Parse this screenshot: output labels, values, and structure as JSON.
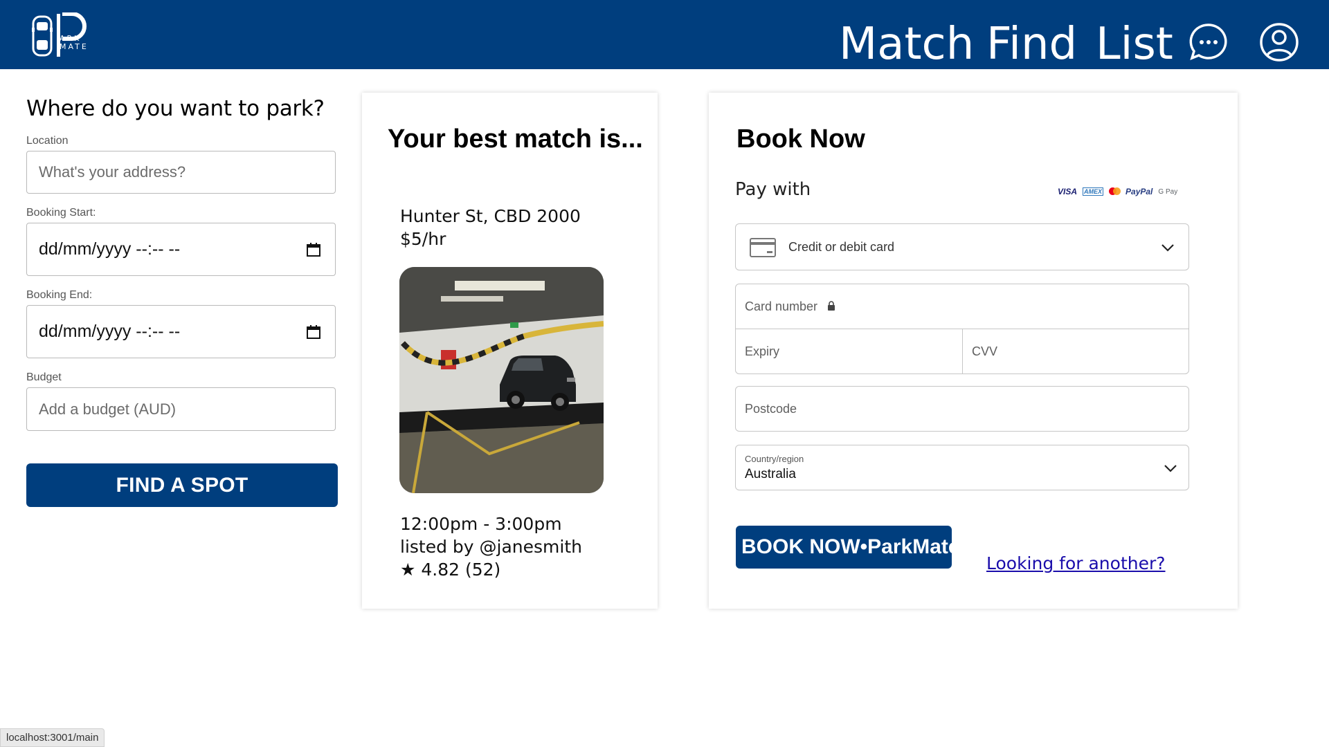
{
  "header": {
    "logo_text": "ARK MATE",
    "nav": [
      "Match",
      "Find",
      "List"
    ],
    "chat_icon": "chat-bubble-icon",
    "profile_icon": "user-circle-icon",
    "bg_color": "#003e7e"
  },
  "search": {
    "title": "Where do you want to park?",
    "location_label": "Location",
    "location_placeholder": "What's your address?",
    "start_label": "Booking Start:",
    "start_value": "dd/mm/yyyy --:-- --",
    "end_label": "Booking End:",
    "end_value": "dd/mm/yyyy --:-- --",
    "budget_label": "Budget",
    "budget_placeholder": "Add a budget (AUD)",
    "button": "FIND A SPOT"
  },
  "match": {
    "title": "Your best match is...",
    "address": "Hunter St, CBD 2000",
    "price": "$5/hr",
    "time": "12:00pm - 3:00pm",
    "listed_by": "listed by @janesmith",
    "rating": "★ 4.82 (52)"
  },
  "book": {
    "title": "Book Now",
    "pay_with": "Pay with",
    "pay_brands": [
      "VISA",
      "AMEX",
      "PayPal",
      "G Pay"
    ],
    "method": "Credit or debit card",
    "card_number": "Card number",
    "expiry": "Expiry",
    "cvv": "CVV",
    "postcode": "Postcode",
    "country_label": "Country/region",
    "country_value": "Australia",
    "button": "BOOK NOW•ParkMate",
    "looking_link": "Looking for another?"
  },
  "status_bar": "localhost:3001/main"
}
